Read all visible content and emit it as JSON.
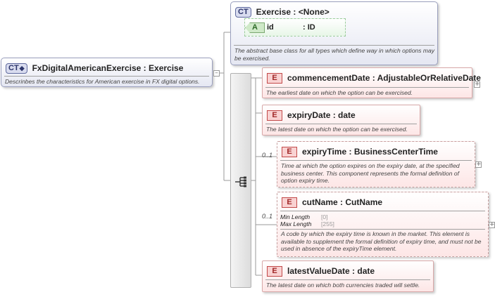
{
  "root": {
    "tag": "CT",
    "name": "FxDigitalAmericanExercise",
    "type": "Exercise",
    "description": "Descrinbes the characteristics for American exercise in FX digital options."
  },
  "base": {
    "tag": "CT",
    "name": "Exercise",
    "type": "<None>",
    "description": "The abstract base class for all types which define way in which options may be exercised.",
    "attribute": {
      "tag": "A",
      "name": "id",
      "type": ": ID"
    }
  },
  "elements": [
    {
      "tag": "E",
      "name": "commencementDate",
      "type": "AdjustableOrRelativeDate",
      "description": "The earliest date on which the option can be exercised.",
      "cardinality": ""
    },
    {
      "tag": "E",
      "name": "expiryDate",
      "type": "date",
      "description": "The latest date on which the option can be exercised.",
      "cardinality": ""
    },
    {
      "tag": "E",
      "name": "expiryTime",
      "type": "BusinessCenterTime",
      "description": "Time at which the option expires on the expiry date, at the specified business center. This component represents the formal definition of option expiry time.",
      "cardinality": "0..1"
    },
    {
      "tag": "E",
      "name": "cutName",
      "type": "CutName",
      "description": "A code by which the expiry time is known in the market. This element is available to supplement the formal definition of expiry time, and must not be used in absence of the expiryTime element.",
      "cardinality": "0..1",
      "facets": [
        {
          "label": "Min Length",
          "value": "[0]"
        },
        {
          "label": "Max Length",
          "value": "[255]"
        }
      ]
    },
    {
      "tag": "E",
      "name": "latestValueDate",
      "type": "date",
      "description": "The latest date on which both currencies traded will settle.",
      "cardinality": ""
    }
  ],
  "icons": {
    "expand": "plus-icon",
    "collapse": "minus-icon",
    "sequence": "sequence-icon"
  }
}
